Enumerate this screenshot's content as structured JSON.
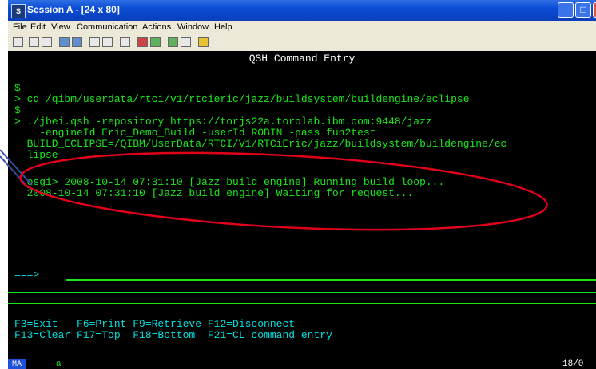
{
  "window": {
    "title": "Session A - [24 x 80]",
    "controls": {
      "minimize": "_",
      "maximize": "□",
      "close": "x"
    }
  },
  "menu": [
    "File",
    "Edit",
    "View",
    "Communication",
    "Actions",
    "Window",
    "Help"
  ],
  "toolbar": {
    "icons": [
      "print-icon",
      "copy-icon",
      "paste-icon",
      "send-icon",
      "receive-icon",
      "display-icon",
      "keyboard-icon",
      "color-icon",
      "record-icon",
      "play-icon",
      "macro-icon",
      "help-icon",
      "settings-icon"
    ]
  },
  "terminal": {
    "screen_title": "QSH Command Entry",
    "lines": [
      "$",
      "> cd /qibm/userdata/rtci/v1/rtcieric/jazz/buildsystem/buildengine/eclipse",
      "$",
      "> ./jbei.qsh -repository https://torjs22a.torolab.ibm.com:9448/jazz",
      "    -engineId Eric_Demo_Build -userId ROBIN -pass fun2test",
      "  BUILD_ECLIPSE=/QIBM/UserData/RTCI/V1/RTCiEric/jazz/buildsystem/buildengine/ec",
      "  lipse",
      "  osgi> 2008-10-14 07:31:10 [Jazz build engine] Running build loop...",
      "  2008-10-14 07:31:10 [Jazz build engine] Waiting for request..."
    ],
    "prompt": "===>",
    "fkeys_line1": "F3=Exit   F6=Print F9=Retrieve F12=Disconnect",
    "fkeys_line2": "F13=Clear F17=Top  F18=Bottom  F21=CL command entry"
  },
  "status": {
    "mode": "MA",
    "indicator": "a",
    "cursor_position": "18/0"
  },
  "colors": {
    "terminal_bg": "#000000",
    "terminal_text": "#19e619",
    "highlight_ellipse": "#e0001a",
    "titlebar": "#0a4cd6"
  }
}
